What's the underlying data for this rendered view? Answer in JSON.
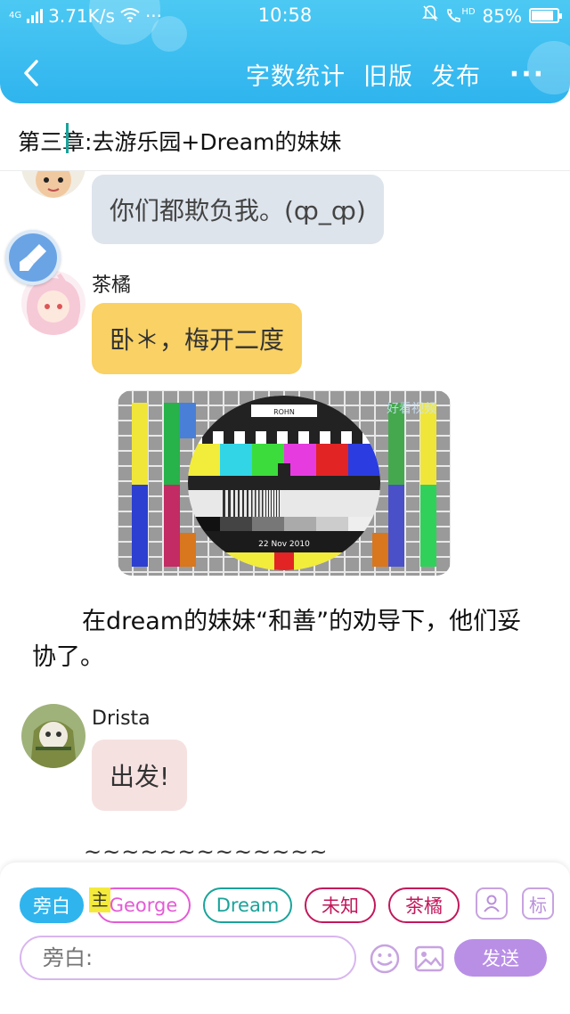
{
  "status_bar": {
    "network_type": "4G",
    "speed": "3.71K/s",
    "more": "···",
    "time": "10:58",
    "hd": "HD",
    "battery": "85%",
    "battery_level": 0.85
  },
  "header": {
    "word_count": "字数统计",
    "old_version": "旧版",
    "publish": "发布",
    "more": "···"
  },
  "chapter_title": "第三章:去游乐园+Dream的妹妹",
  "messages": [
    {
      "text": "你们都欺负我。(ȹ_ȹ)"
    },
    {
      "name": "茶橘",
      "text": "卧＊，梅开二度"
    },
    {
      "image_watermark": "好看视频",
      "card_top": "ROHN",
      "card_bottom": "22 Nov 2010"
    },
    {
      "narration": "在dream的妹妹“和善”的劝导下，他们妥协了。"
    },
    {
      "name": "Drista",
      "text": "出发!"
    }
  ],
  "tilde_line": "~~~~~~~~~~~~~",
  "roles": {
    "narrator": "旁白",
    "main_badge": "主",
    "george": "George",
    "dream": "Dream",
    "unknown": "未知",
    "chaju": "茶橘",
    "tag": "标"
  },
  "input": {
    "placeholder": "旁白:"
  },
  "send": "发送",
  "colors": {
    "header": "#2fb4ee",
    "bubble_gray": "#dde4ec",
    "bubble_yellow": "#f9d164",
    "bubble_pink": "#f6e1e1",
    "george": "#e45ad6",
    "dream": "#1aa39a",
    "unknown": "#c2185b",
    "chaju": "#c2185b",
    "send": "#b98fe6"
  }
}
